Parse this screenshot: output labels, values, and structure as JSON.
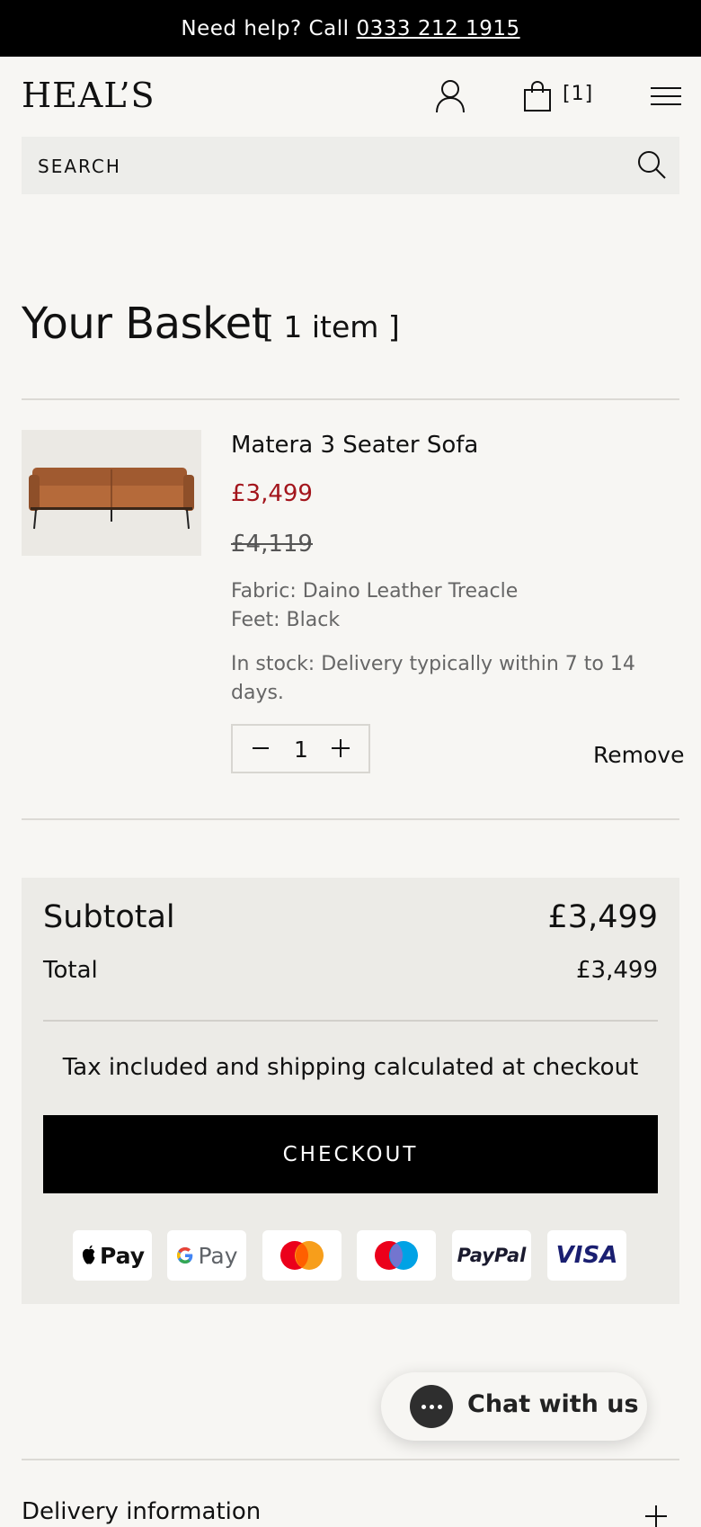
{
  "topbar": {
    "prefix": "Need help? Call",
    "phone": "0333 212 1915"
  },
  "header": {
    "logo": "HEAL’S",
    "cart_count": "[1]"
  },
  "search": {
    "placeholder": "SEARCH"
  },
  "basket": {
    "title": "Your Basket",
    "item_count": "[ 1 item ]",
    "item": {
      "name": "Matera 3 Seater Sofa",
      "price": "£3,499",
      "was_price": "£4,119",
      "fabric": "Fabric: Daino Leather Treacle",
      "feet": "Feet: Black",
      "stock": "In stock: Delivery typically within 7 to 14 days.",
      "quantity": "1",
      "remove_label": "Remove"
    }
  },
  "summary": {
    "subtotal_label": "Subtotal",
    "subtotal_value": "£3,499",
    "total_label": "Total",
    "total_value": "£3,499",
    "tax_note": "Tax included and shipping calculated at checkout",
    "checkout_label": "CHECKOUT",
    "payment_methods": {
      "apple": "Pay",
      "google": "Pay",
      "paypal": "PayPal",
      "visa": "VISA"
    }
  },
  "chat": {
    "label": "Chat with us"
  },
  "accordion": {
    "delivery": "Delivery information"
  },
  "colors": {
    "sale_price": "#a3151c",
    "checkout_bg": "#000000",
    "page_bg": "#f7f6f3"
  }
}
